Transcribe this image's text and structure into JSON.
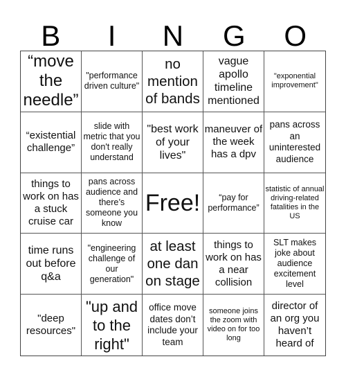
{
  "header": {
    "letters": [
      "B",
      "I",
      "N",
      "G",
      "O"
    ]
  },
  "cells": [
    "“move the needle”",
    "\"performance driven culture\"",
    "no mention of bands",
    "vague apollo timeline mentioned",
    "\"exponential improvement\"",
    "“existential challenge”",
    "slide with metric that you don't really understand",
    "\"best work of your lives\"",
    "maneuver of the week has a dpv",
    "pans across an uninterested audience",
    "things to work on has a stuck cruise car",
    "pans across audience and there’s someone you know",
    "Free!",
    "“pay for performance”",
    "statistic of annual driving-related fatalities in the US",
    "time runs out before q&a",
    "\"engineering challenge of our generation\"",
    "at least one dan on stage",
    "things to work on has a near collision",
    "SLT makes joke about audience excitement level",
    "\"deep resources\"",
    "\"up and to the right\"",
    "office move dates don’t include your team",
    "someone joins the zoom with video on for too long",
    "director of an org you haven’t heard of"
  ]
}
